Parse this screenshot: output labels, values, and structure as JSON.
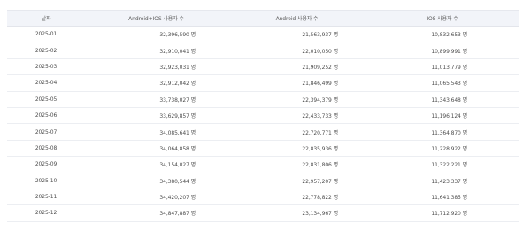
{
  "table": {
    "headers": {
      "month": "날짜",
      "total": "Android+IOS 사용자 수",
      "android": "Android 사용자 수",
      "ios": "IOS 사용자 수"
    },
    "rows": [
      {
        "month": "2025-01",
        "total": "32,396,590 명",
        "android": "21,563,937 명",
        "ios": "10,832,653 명"
      },
      {
        "month": "2025-02",
        "total": "32,910,041 명",
        "android": "22,010,050 명",
        "ios": "10,899,991 명"
      },
      {
        "month": "2025-03",
        "total": "32,923,031 명",
        "android": "21,909,252 명",
        "ios": "11,013,779 명"
      },
      {
        "month": "2025-04",
        "total": "32,912,042 명",
        "android": "21,846,499 명",
        "ios": "11,065,543 명"
      },
      {
        "month": "2025-05",
        "total": "33,738,027 명",
        "android": "22,394,379 명",
        "ios": "11,343,648 명"
      },
      {
        "month": "2025-06",
        "total": "33,629,857 명",
        "android": "22,433,733 명",
        "ios": "11,196,124 명"
      },
      {
        "month": "2025-07",
        "total": "34,085,641 명",
        "android": "22,720,771 명",
        "ios": "11,364,870 명"
      },
      {
        "month": "2025-08",
        "total": "34,064,858 명",
        "android": "22,835,936 명",
        "ios": "11,228,922 명"
      },
      {
        "month": "2025-09",
        "total": "34,154,027 명",
        "android": "22,831,806 명",
        "ios": "11,322,221 명"
      },
      {
        "month": "2025-10",
        "total": "34,380,544 명",
        "android": "22,957,207 명",
        "ios": "11,423,337 명"
      },
      {
        "month": "2025-11",
        "total": "34,420,207 명",
        "android": "22,778,822 명",
        "ios": "11,641,385 명"
      },
      {
        "month": "2025-12",
        "total": "34,847,887 명",
        "android": "23,134,967 명",
        "ios": "11,712,920 명"
      }
    ]
  }
}
